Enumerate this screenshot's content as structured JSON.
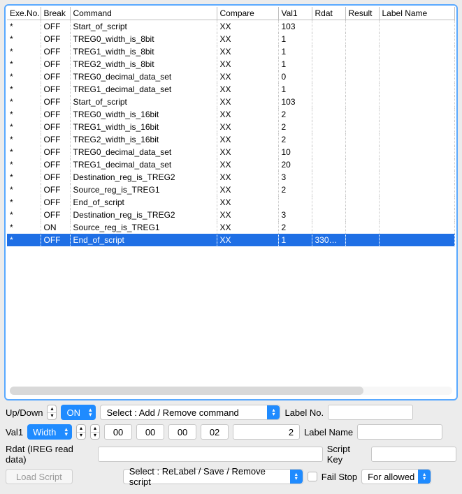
{
  "columns": [
    "Exe.No.",
    "Break",
    "Command",
    "Compare",
    "Val1",
    "Rdat",
    "Result",
    "Label Name"
  ],
  "rows": [
    {
      "exe": "*",
      "break": "OFF",
      "command": "Start_of_script",
      "compare": "XX",
      "val1": "103",
      "rdat": "",
      "result": "",
      "label": ""
    },
    {
      "exe": "*",
      "break": "OFF",
      "command": "TREG0_width_is_8bit",
      "compare": "XX",
      "val1": "1",
      "rdat": "",
      "result": "",
      "label": ""
    },
    {
      "exe": "*",
      "break": "OFF",
      "command": "TREG1_width_is_8bit",
      "compare": "XX",
      "val1": "1",
      "rdat": "",
      "result": "",
      "label": ""
    },
    {
      "exe": "*",
      "break": "OFF",
      "command": "TREG2_width_is_8bit",
      "compare": "XX",
      "val1": "1",
      "rdat": "",
      "result": "",
      "label": ""
    },
    {
      "exe": "*",
      "break": "OFF",
      "command": "TREG0_decimal_data_set",
      "compare": "XX",
      "val1": "0",
      "rdat": "",
      "result": "",
      "label": ""
    },
    {
      "exe": "*",
      "break": "OFF",
      "command": "TREG1_decimal_data_set",
      "compare": "XX",
      "val1": "1",
      "rdat": "",
      "result": "",
      "label": ""
    },
    {
      "exe": "*",
      "break": "OFF",
      "command": "Start_of_script",
      "compare": "XX",
      "val1": "103",
      "rdat": "",
      "result": "",
      "label": ""
    },
    {
      "exe": "*",
      "break": "OFF",
      "command": "TREG0_width_is_16bit",
      "compare": "XX",
      "val1": "2",
      "rdat": "",
      "result": "",
      "label": ""
    },
    {
      "exe": "*",
      "break": "OFF",
      "command": "TREG1_width_is_16bit",
      "compare": "XX",
      "val1": "2",
      "rdat": "",
      "result": "",
      "label": ""
    },
    {
      "exe": "*",
      "break": "OFF",
      "command": "TREG2_width_is_16bit",
      "compare": "XX",
      "val1": "2",
      "rdat": "",
      "result": "",
      "label": ""
    },
    {
      "exe": "*",
      "break": "OFF",
      "command": "TREG0_decimal_data_set",
      "compare": "XX",
      "val1": "10",
      "rdat": "",
      "result": "",
      "label": ""
    },
    {
      "exe": "*",
      "break": "OFF",
      "command": "TREG1_decimal_data_set",
      "compare": "XX",
      "val1": "20",
      "rdat": "",
      "result": "",
      "label": ""
    },
    {
      "exe": "*",
      "break": "OFF",
      "command": "Destination_reg_is_TREG2",
      "compare": "XX",
      "val1": "3",
      "rdat": "",
      "result": "",
      "label": ""
    },
    {
      "exe": "*",
      "break": "OFF",
      "command": "Source_reg_is_TREG1",
      "compare": "XX",
      "val1": "2",
      "rdat": "",
      "result": "",
      "label": ""
    },
    {
      "exe": "*",
      "break": "OFF",
      "command": "End_of_script",
      "compare": "XX",
      "val1": "",
      "rdat": "",
      "result": "",
      "label": ""
    },
    {
      "exe": "*",
      "break": "OFF",
      "command": "Destination_reg_is_TREG2",
      "compare": "XX",
      "val1": "3",
      "rdat": "",
      "result": "",
      "label": ""
    },
    {
      "exe": "*",
      "break": "ON",
      "command": "Source_reg_is_TREG1",
      "compare": "XX",
      "val1": "2",
      "rdat": "",
      "result": "",
      "label": ""
    },
    {
      "exe": "*",
      "break": "OFF",
      "command": "End_of_script",
      "compare": "XX",
      "val1": "1",
      "rdat": "330…",
      "result": "",
      "label": "",
      "selected": true
    }
  ],
  "form": {
    "updown_label": "Up/Down",
    "on_select": "ON",
    "command_select": "Select : Add / Remove command",
    "labelno_label": "Label No.",
    "labelno_value": "",
    "val1_label": "Val1",
    "width_select": "Width",
    "hex": [
      "00",
      "00",
      "00",
      "02"
    ],
    "num_value": "2",
    "labelname_label": "Label Name",
    "labelname_value": "",
    "rdat_label": "Rdat (IREG read data)",
    "rdat_value": "",
    "scriptkey_label": "Script Key",
    "scriptkey_value": "",
    "loadscript_label": "Load Script",
    "script_select": "Select : ReLabel / Save / Remove script",
    "failstop_label": "Fail Stop",
    "forallowed_select": "For allowed"
  }
}
